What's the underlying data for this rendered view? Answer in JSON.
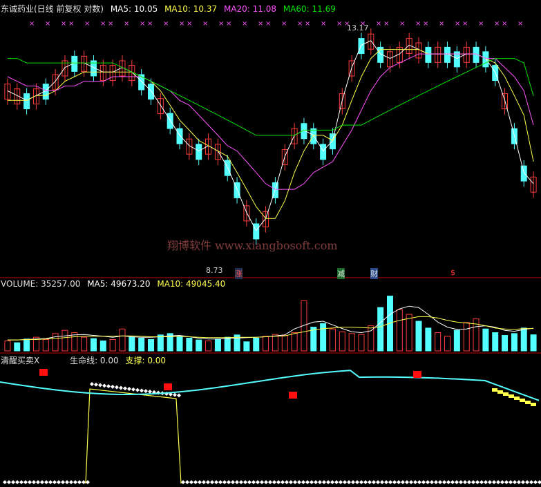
{
  "header": {
    "title": "东诚药业(日线 前复权 对数)",
    "ma5": "MA5: 10.05",
    "ma10": "MA10: 10.37",
    "ma20": "MA20: 11.08",
    "ma60": "MA60: 11.69"
  },
  "volume_header": {
    "label": "VOLUME: 35257.00",
    "ma5": "MA5: 49673.20",
    "ma10": "MA10: 49045.40"
  },
  "indicator_header": {
    "label": "清醒买卖X",
    "life": "生命线: 0.00",
    "support": "支撑: 0.00"
  },
  "watermark": "翔博软件 www.xiangbosoft.com",
  "annotations": {
    "high": "13.17",
    "low": "8.73",
    "tag_zhang": "涨",
    "tag_jian": "减",
    "tag_cai": "财",
    "tag_s": "$"
  },
  "colors": {
    "up": "#ff3c3c",
    "down": "#54ffff",
    "ma5": "#ffffff",
    "ma10": "#ffff4c",
    "ma20": "#ff54ff",
    "ma60": "#00e600",
    "axis": "#c00000"
  },
  "chart_data": [
    {
      "type": "candlestick",
      "title": "东诚药业(日线 前复权 对数)",
      "ylim": [
        8.5,
        13.5
      ],
      "series": [
        {
          "name": "MA5",
          "values": [
            11.8,
            11.7,
            11.6,
            11.7,
            11.8,
            12.0,
            12.3,
            12.4,
            12.4,
            12.3,
            12.2,
            12.2,
            12.3,
            12.2,
            12.0,
            11.8,
            11.5,
            11.2,
            10.9,
            10.7,
            10.6,
            10.7,
            10.6,
            10.3,
            9.9,
            9.5,
            9.2,
            9.4,
            9.9,
            10.5,
            10.9,
            11.0,
            10.9,
            10.6,
            10.8,
            11.6,
            12.3,
            12.8,
            12.9,
            12.6,
            12.5,
            12.6,
            12.8,
            12.7,
            12.6,
            12.6,
            12.6,
            12.5,
            12.6,
            12.6,
            12.5,
            12.2,
            11.6,
            10.9,
            10.2,
            10.0
          ]
        },
        {
          "name": "MA10",
          "values": [
            11.6,
            11.6,
            11.6,
            11.7,
            11.7,
            11.8,
            12.0,
            12.1,
            12.2,
            12.2,
            12.2,
            12.2,
            12.2,
            12.2,
            12.1,
            12.0,
            11.8,
            11.5,
            11.2,
            11.0,
            10.8,
            10.7,
            10.6,
            10.5,
            10.2,
            9.9,
            9.6,
            9.4,
            9.4,
            9.7,
            10.2,
            10.6,
            10.9,
            10.9,
            10.8,
            11.1,
            11.6,
            12.1,
            12.5,
            12.7,
            12.7,
            12.7,
            12.7,
            12.7,
            12.6,
            12.6,
            12.6,
            12.6,
            12.6,
            12.6,
            12.5,
            12.4,
            12.1,
            11.7,
            11.3,
            10.4
          ]
        },
        {
          "name": "MA20",
          "values": [
            12.1,
            12.0,
            11.9,
            11.9,
            11.8,
            11.8,
            11.9,
            11.9,
            12.0,
            12.0,
            12.0,
            12.1,
            12.1,
            12.1,
            12.1,
            12.0,
            11.9,
            11.8,
            11.6,
            11.5,
            11.3,
            11.1,
            10.9,
            10.7,
            10.6,
            10.4,
            10.2,
            10.0,
            9.9,
            9.9,
            9.9,
            10.0,
            10.2,
            10.3,
            10.4,
            10.7,
            11.0,
            11.4,
            11.8,
            12.1,
            12.3,
            12.4,
            12.5,
            12.6,
            12.6,
            12.6,
            12.6,
            12.6,
            12.6,
            12.6,
            12.5,
            12.5,
            12.3,
            12.1,
            11.8,
            11.1
          ]
        },
        {
          "name": "MA60",
          "values": [
            12.5,
            12.5,
            12.4,
            12.4,
            12.4,
            12.4,
            12.4,
            12.4,
            12.4,
            12.4,
            12.4,
            12.4,
            12.3,
            12.2,
            12.1,
            12.0,
            11.9,
            11.8,
            11.7,
            11.6,
            11.5,
            11.4,
            11.3,
            11.2,
            11.1,
            11.0,
            10.9,
            10.9,
            10.9,
            10.9,
            10.9,
            11.0,
            11.0,
            11.0,
            11.0,
            11.1,
            11.1,
            11.1,
            11.2,
            11.3,
            11.4,
            11.5,
            11.6,
            11.7,
            11.8,
            11.9,
            12.0,
            12.1,
            12.2,
            12.3,
            12.4,
            12.5,
            12.5,
            12.5,
            12.4,
            11.69
          ]
        }
      ]
    },
    {
      "type": "bar",
      "title": "VOLUME",
      "values": [
        22000,
        18000,
        26000,
        30000,
        25000,
        38000,
        45000,
        40000,
        30000,
        27000,
        22000,
        25000,
        48000,
        30000,
        28000,
        25000,
        35000,
        38000,
        32000,
        28000,
        24000,
        22000,
        26000,
        30000,
        35000,
        20000,
        28000,
        32000,
        36000,
        34000,
        40000,
        110000,
        52000,
        60000,
        48000,
        42000,
        38000,
        36000,
        55000,
        95000,
        120000,
        90000,
        80000,
        65000,
        50000,
        40000,
        32000,
        45000,
        62000,
        70000,
        48000,
        40000,
        34000,
        38000,
        50000,
        35257
      ],
      "series": [
        {
          "name": "MA5",
          "values": [
            24000,
            24000,
            25000,
            26000,
            27000,
            31000,
            33000,
            35000,
            36000,
            34000,
            32000,
            30000,
            33000,
            31000,
            30000,
            30000,
            31000,
            33000,
            34000,
            31000,
            28000,
            26000,
            26000,
            27000,
            28000,
            29000,
            30000,
            31000,
            33000,
            35000,
            48000,
            56000,
            63000,
            65000,
            57000,
            49000,
            42000,
            40000,
            44000,
            62000,
            80000,
            92000,
            98000,
            95000,
            80000,
            63000,
            52000,
            47000,
            48000,
            53000,
            55000,
            52000,
            45000,
            43000,
            47000,
            49673.2
          ]
        },
        {
          "name": "MA10",
          "values": [
            24000,
            24000,
            25000,
            25000,
            26000,
            27000,
            29000,
            31000,
            32000,
            32000,
            32000,
            32000,
            33000,
            33000,
            32000,
            31000,
            31000,
            31000,
            32000,
            31000,
            30000,
            29000,
            29000,
            29000,
            30000,
            30000,
            30000,
            31000,
            32000,
            33000,
            38000,
            42000,
            46000,
            49000,
            50000,
            52000,
            52000,
            51000,
            50000,
            53000,
            61000,
            67000,
            71000,
            75000,
            75000,
            72000,
            67000,
            63000,
            61000,
            59000,
            55000,
            50000,
            48000,
            47000,
            49000,
            49045.4
          ]
        }
      ]
    },
    {
      "type": "line",
      "title": "清醒买卖X",
      "series": [
        {
          "name": "生命线",
          "values": [
            0.0
          ]
        },
        {
          "name": "支撑",
          "values": [
            0.0
          ]
        }
      ]
    }
  ]
}
